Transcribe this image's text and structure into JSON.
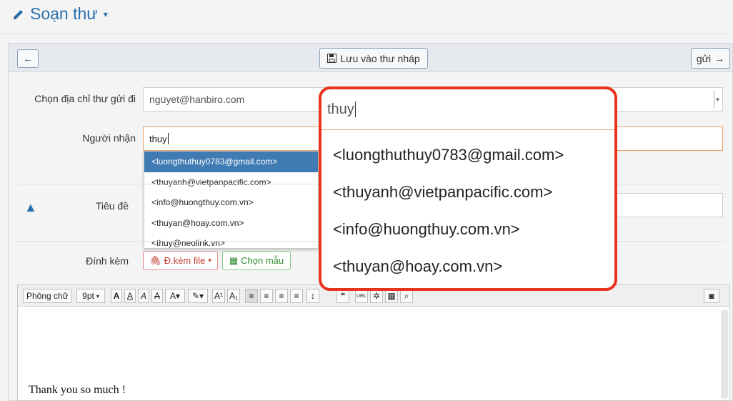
{
  "header": {
    "title": "Soạn thư"
  },
  "toolbar": {
    "back": "←",
    "draft_label": "Lưu vào thư nháp",
    "send_label": "gửi"
  },
  "from": {
    "label": "Chọn địa chỉ thư gửi đi",
    "value": "nguyet@hanbiro.com"
  },
  "to": {
    "label": "Người nhận",
    "value": "thuy"
  },
  "suggestions": [
    "<luongthuthuy0783@gmail.com>",
    "<thuyanh@vietpanpacific.com>",
    "<info@huongthuy.com.vn>",
    "<thuyan@hoay.com.vn>",
    "<thuy@neolink.vn>"
  ],
  "subject": {
    "label": "Tiêu đề"
  },
  "attach": {
    "label": "Đính kèm",
    "file_btn": "Đ.kèm file",
    "template_btn": "Chọn mẫu"
  },
  "editor": {
    "font": "Phông chữ",
    "size": "9pt",
    "body": "Thank you so much !"
  },
  "zoom": {
    "query": "thuy",
    "items": [
      "<luongthuthuy0783@gmail.com>",
      "<thuyanh@vietpanpacific.com>",
      "<info@huongthuy.com.vn>",
      "<thuyan@hoay.com.vn>"
    ]
  },
  "colors": {
    "accent": "#2a6fae",
    "highlight": "#3f7ab3",
    "callout": "#e8341c"
  }
}
